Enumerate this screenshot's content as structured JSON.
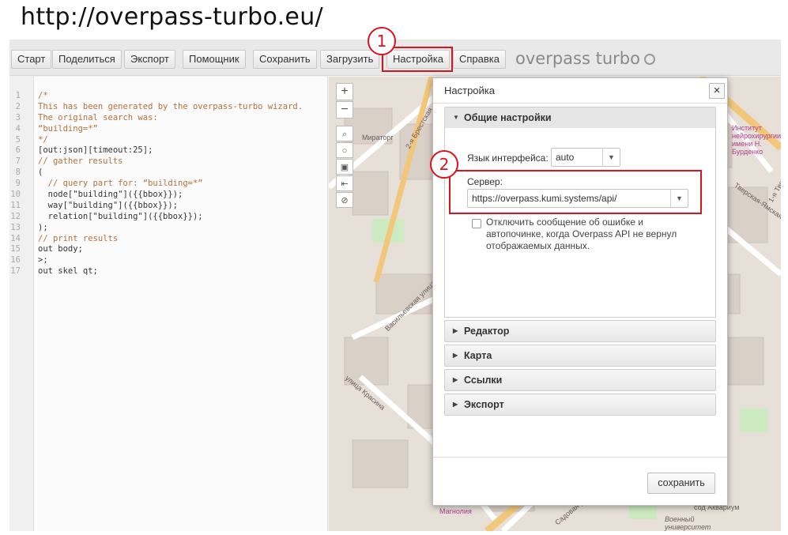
{
  "header_url": "http://overpass-turbo.eu/",
  "toolbar": {
    "buttons": [
      "Старт",
      "Поделиться",
      "Экспорт",
      "Помощник",
      "Сохранить",
      "Загрузить",
      "Настройка",
      "Справка"
    ],
    "app_name": "overpass turbo"
  },
  "editor": {
    "line_numbers": [
      "1",
      "2",
      "3",
      "4",
      "5",
      "6",
      "7",
      "8",
      "9",
      "10",
      "11",
      "12",
      "13",
      "14",
      "15",
      "16",
      "17"
    ],
    "lines": [
      "/*",
      "This has been generated by the overpass-turbo wizard.",
      "The original search was:",
      "“building=*”",
      "*/",
      "[out:json][timeout:25];",
      "// gather results",
      "(",
      "  // query part for: “building=*”",
      "  node[\"building\"]({{bbox}});",
      "  way[\"building\"]({{bbox}});",
      "  relation[\"building\"]({{bbox}});",
      ");",
      "// print results",
      "out body;",
      ">;",
      "out skel qt;"
    ]
  },
  "map": {
    "labels": [
      "Мираторг",
      "2-я Брестская",
      "Васильевская улица",
      "улица Красина",
      "Магнолия",
      "Институт нейрохирургии имени Н. Бурденко",
      "Тверская-Ямская улица",
      "1-я Тверская",
      "сод Аквариум",
      "Военный университет Министерства Обороны",
      "Садовая улица"
    ],
    "zoom_in": "+",
    "zoom_out": "−"
  },
  "dialog": {
    "title": "Настройка",
    "close": "×",
    "general_section": "Общие настройки",
    "language_label": "Язык интерфейса:",
    "language_value": "auto",
    "server_label": "Сервер:",
    "server_value": "https://overpass.kumi.systems/api/",
    "checkbox_label": "Отключить сообщение об ошибке и автопочинке, когда Overpass API не вернул отображаемых данных.",
    "sections": [
      "Редактор",
      "Карта",
      "Ссылки",
      "Экспорт"
    ],
    "save_button": "сохранить"
  },
  "annotations": [
    "1",
    "2"
  ],
  "colors": {
    "highlight": "#d9141e",
    "accent_gray": "#8a8a8a"
  }
}
